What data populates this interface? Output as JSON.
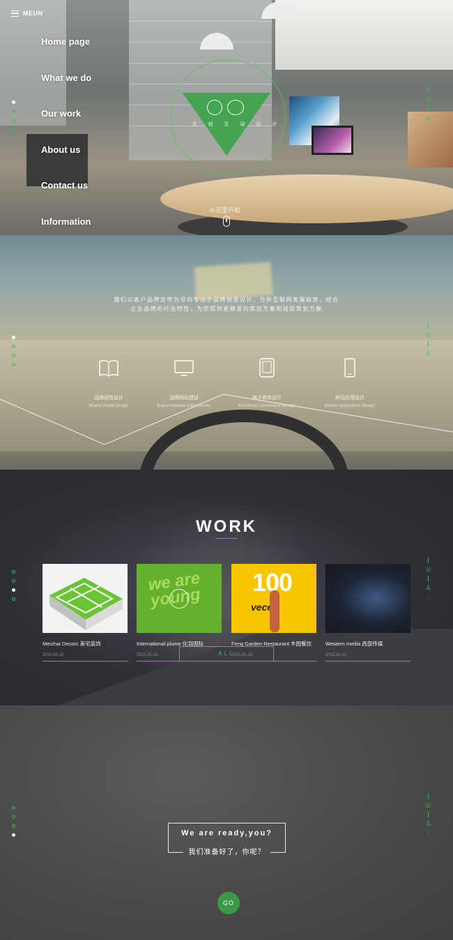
{
  "menu": {
    "label": "MEUN"
  },
  "nav": {
    "items": [
      "Home page",
      "What we do",
      "Our work",
      "About us",
      "Contact us",
      "Information"
    ]
  },
  "hero": {
    "logo_caption": "文 创 互 动 设 计",
    "start_text": "从这里开始"
  },
  "services": {
    "intro_line1": "我们以客户品牌宣传为导向专注于品牌创意设计，分析互联网发展趋势，结合",
    "intro_line2": "企业品牌的行业特性，为您提供更精准的策划方案和视觉策划方案",
    "items": [
      {
        "cn": "品牌视觉设计",
        "en": "Brand visual design",
        "icon": "book-icon"
      },
      {
        "cn": "品牌网站建设",
        "en": "Brand website construction",
        "icon": "monitor-icon"
      },
      {
        "cn": "电子商务设计",
        "en": "Electronic commerce design",
        "icon": "tablet-icon"
      },
      {
        "cn": "移动应用设计",
        "en": "Mobile application design",
        "icon": "phone-icon"
      }
    ]
  },
  "work": {
    "title": "WORK",
    "items": [
      {
        "title": "Meizhai Decorc 美宅装饰",
        "date": "2015.05.18",
        "thumb": "green-3d-floorplan"
      },
      {
        "title": "International plume 化羽国际",
        "date": "2015.05.18",
        "thumb": "we-are-young-green"
      },
      {
        "title": "Feng Garden Restaurant 丰园餐饮",
        "date": "2015.05.18",
        "thumb": "100-veces-yellow"
      },
      {
        "title": "Western media 西部传媒",
        "date": "2015.05.18",
        "thumb": "blue-dancer-dark"
      }
    ],
    "thumb_texts": [
      "we are young",
      "100",
      "veces"
    ],
    "all_label": "ALL"
  },
  "ready": {
    "en": "We are ready,you?",
    "cn": "我们准备好了，你呢？",
    "go_label": "GO"
  },
  "colors": {
    "accent": "#3fbf4f",
    "dark": "#2a2a30",
    "go": "#3a9a48"
  }
}
